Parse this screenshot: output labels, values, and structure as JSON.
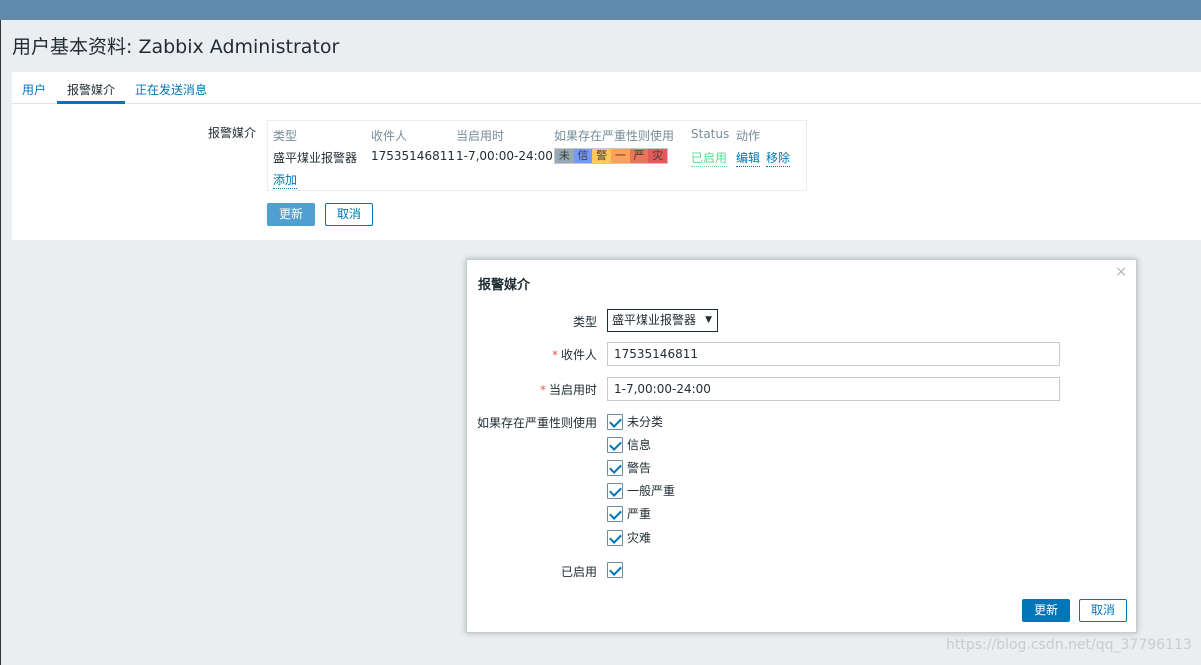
{
  "page": {
    "title": "用户基本资料: Zabbix Administrator"
  },
  "tabs": [
    {
      "label": "用户"
    },
    {
      "label": "报警媒介"
    },
    {
      "label": "正在发送消息"
    }
  ],
  "media_form": {
    "label": "报警媒介",
    "columns": {
      "type": "类型",
      "send_to": "收件人",
      "when_active": "当启用时",
      "severity": "如果存在严重性则使用",
      "status": "Status",
      "action": "动作"
    },
    "row": {
      "type": "盛平煤业报警器",
      "send_to": "17535146811",
      "when_active": "1-7,00:00-24:00",
      "severity": [
        {
          "abbr": "未",
          "color": "#97aab3"
        },
        {
          "abbr": "信",
          "color": "#7499ff"
        },
        {
          "abbr": "警",
          "color": "#ffc859"
        },
        {
          "abbr": "一",
          "color": "#ffa059"
        },
        {
          "abbr": "严",
          "color": "#e97659"
        },
        {
          "abbr": "灾",
          "color": "#e45959"
        }
      ],
      "status": "已启用",
      "edit": "编辑",
      "remove": "移除"
    },
    "add": "添加",
    "update": "更新",
    "cancel": "取消"
  },
  "modal": {
    "title": "报警媒介",
    "close": "×",
    "type_label": "类型",
    "type_value": "盛平煤业报警器",
    "sendto_label": "收件人",
    "sendto_value": "17535146811",
    "period_label": "当启用时",
    "period_value": "1-7,00:00-24:00",
    "severity_label": "如果存在严重性则使用",
    "severities": [
      "未分类",
      "信息",
      "警告",
      "一般严重",
      "严重",
      "灾难"
    ],
    "enabled_label": "已启用",
    "update": "更新",
    "cancel": "取消",
    "required_mark": "*"
  },
  "watermark": "https://blog.csdn.net/qq_37796113"
}
